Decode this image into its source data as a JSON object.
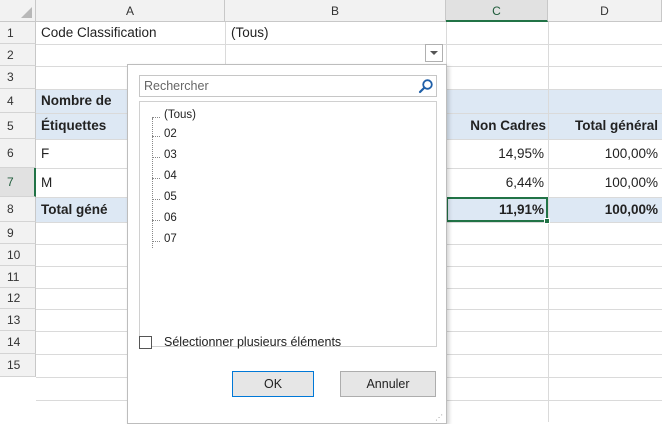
{
  "columns": [
    "A",
    "B",
    "C",
    "D"
  ],
  "rows": [
    "1",
    "2",
    "3",
    "4",
    "5",
    "6",
    "7",
    "8",
    "9",
    "10",
    "11",
    "12",
    "13",
    "14",
    "15"
  ],
  "cells": {
    "a1": "Code Classification",
    "b1": "(Tous)",
    "a3": "Nombre de",
    "a4": "Étiquettes",
    "c4": "Non Cadres",
    "d4": "Total général",
    "a5": "F",
    "c5": "14,95%",
    "d5": "100,00%",
    "a6": "M",
    "c6": "6,44%",
    "d6": "100,00%",
    "a7": "Total géné",
    "c7": "11,91%",
    "d7": "100,00%"
  },
  "filter_panel": {
    "search_placeholder": "Rechercher",
    "items": [
      "(Tous)",
      "02",
      "03",
      "04",
      "05",
      "06",
      "07"
    ],
    "multi_select_label": "Sélectionner plusieurs éléments",
    "ok_label": "OK",
    "cancel_label": "Annuler"
  },
  "colors": {
    "accent": "#217346",
    "pivot_band": "#dde8f4"
  },
  "icons": {
    "search": "search-icon",
    "dropdown": "chevron-down-icon"
  }
}
